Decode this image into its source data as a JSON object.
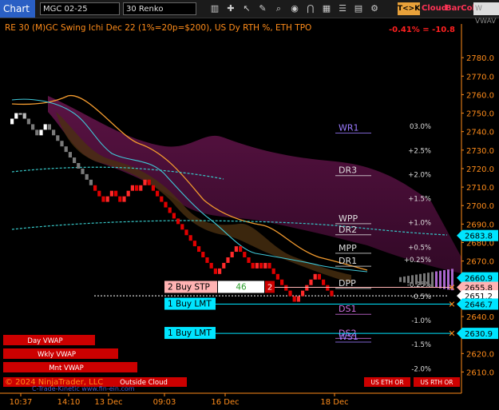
{
  "toolbar": {
    "chart_label": "Chart",
    "symbol": "MGC 02-25",
    "interval": "30 Renko",
    "icons": [
      "bars-icon",
      "crosshair-icon",
      "pointer-icon",
      "pencil-icon",
      "zoom-icon",
      "eye-icon",
      "magnet-icon",
      "chart-type-icon",
      "list-icon"
    ],
    "tk_label": "T<>K",
    "cloud_label": "Cloud",
    "barcol_label": "BarCol",
    "vw_label": "W VWAV"
  },
  "chart_data": {
    "type": "renko",
    "title": "RE 30 (M)GC Swing Ichi Dec 22 (1%=20p=$200), US Dy RTH %, ETH TPO",
    "change_readout": "-0.41% = -10.8",
    "ylim": [
      2605,
      2790
    ],
    "y_ticks": [
      2610,
      2620,
      2630,
      2640,
      2650,
      2660,
      2670,
      2680,
      2690,
      2700,
      2710,
      2720,
      2730,
      2740,
      2750,
      2760,
      2770,
      2780
    ],
    "x_ticks": [
      "10:37",
      "14:10",
      "13 Dec",
      "09:03",
      "16 Dec",
      "18 Dec"
    ],
    "price_flags": [
      {
        "price": 2683.8,
        "label": "2683.8",
        "color": "#00e5ff"
      },
      {
        "price": 2660.9,
        "label": "2660.9",
        "color": "#00e5ff"
      },
      {
        "price": 2655.8,
        "label": "2655.8",
        "color": "#ffb3b3"
      },
      {
        "price": 2651.2,
        "label": "2651.2",
        "color": "#ffffff"
      },
      {
        "price": 2646.7,
        "label": "2646.7",
        "color": "#00e5ff"
      },
      {
        "price": 2630.9,
        "label": "2630.9",
        "color": "#00e5ff"
      }
    ],
    "pivots": [
      {
        "name": "WR1",
        "price": 2740.5,
        "color": "#9b7bff"
      },
      {
        "name": "DR3",
        "price": 2717.5,
        "color": "#dddddd"
      },
      {
        "name": "WPP",
        "price": 2691.5,
        "color": "#dddddd"
      },
      {
        "name": "DR2",
        "price": 2685.5,
        "color": "#dddddd"
      },
      {
        "name": "MPP",
        "price": 2675.5,
        "color": "#dddddd"
      },
      {
        "name": "DR1",
        "price": 2668.5,
        "color": "#dddddd"
      },
      {
        "name": "DPP",
        "price": 2656.5,
        "color": "#dddddd"
      },
      {
        "name": "DS1",
        "price": 2642.5,
        "color": "#d070e0"
      },
      {
        "name": "DS2",
        "price": 2629.5,
        "color": "#d070e0"
      },
      {
        "name": "WS1",
        "price": 2627.5,
        "color": "#9b7bff"
      }
    ],
    "pct_levels": [
      {
        "label": "03.0%",
        "price": 2741.5
      },
      {
        "label": "+2.5%",
        "price": 2728.5
      },
      {
        "label": "+2.0%",
        "price": 2715.5
      },
      {
        "label": "+1.5%",
        "price": 2702.5
      },
      {
        "label": "+1.0%",
        "price": 2689.5
      },
      {
        "label": "+0.5%",
        "price": 2676.0
      },
      {
        "label": "+0.25%",
        "price": 2669.5
      },
      {
        "label": "-0.25%",
        "price": 2656.0
      },
      {
        "label": "-0.5%",
        "price": 2649.5
      },
      {
        "label": "-1.0%",
        "price": 2636.5
      },
      {
        "label": "-1.5%",
        "price": 2623.5
      },
      {
        "label": "-2.0%",
        "price": 2610.5
      }
    ],
    "renko_close": [
      2747,
      2750,
      2750,
      2747,
      2744,
      2741,
      2738,
      2741,
      2744,
      2741,
      2738,
      2735,
      2732,
      2729,
      2726,
      2723,
      2720,
      2717,
      2714,
      2711,
      2708,
      2705,
      2702,
      2705,
      2708,
      2705,
      2702,
      2705,
      2708,
      2711,
      2708,
      2711,
      2714,
      2711,
      2708,
      2705,
      2702,
      2699,
      2696,
      2693,
      2690,
      2687,
      2684,
      2681,
      2678,
      2675,
      2672,
      2669,
      2666,
      2663,
      2666,
      2669,
      2672,
      2675,
      2678,
      2675,
      2672,
      2669,
      2666,
      2669,
      2666,
      2669,
      2666,
      2663,
      2660,
      2657,
      2654,
      2651,
      2648,
      2651,
      2654,
      2657,
      2660,
      2663,
      2660,
      2657,
      2654,
      2651
    ],
    "orders": [
      {
        "label": "2 Buy STP",
        "qty_text": "46",
        "qty_index": "2",
        "price": 2655.8
      },
      {
        "label": "1 Buy LMT",
        "price": 2646.7
      },
      {
        "label": "1 Buy LMT",
        "price": 2630.9
      }
    ],
    "vwap_boxes": [
      "Day VWAP",
      "Wkly VWAP",
      "Mnt VWAP"
    ],
    "outside_cloud": "Outside Cloud",
    "us_eth_or": [
      "US ETH OR",
      "US RTH OR"
    ],
    "copyright": "© 2024 NinjaTrader, LLC",
    "watermark": "C-Trade-Kinetic   www.fin-ein.com"
  }
}
